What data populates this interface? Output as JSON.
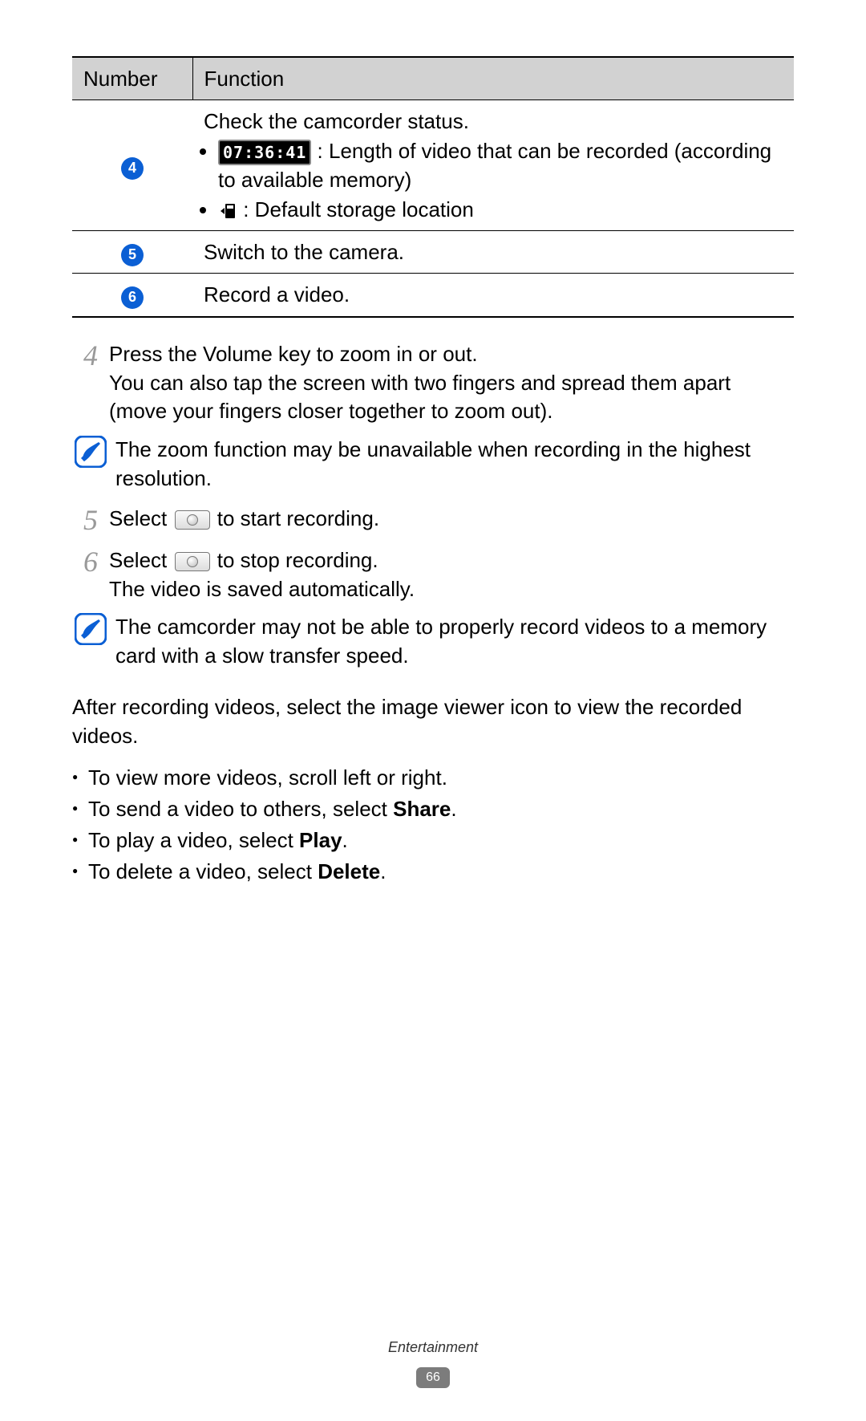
{
  "table": {
    "headers": [
      "Number",
      "Function"
    ],
    "rows": [
      {
        "num": "4",
        "intro": "Check the camcorder status.",
        "bullet1_time": "07:36:41",
        "bullet1_text": " : Length of video that can be recorded (according to available memory)",
        "bullet2_text": " : Default storage location"
      },
      {
        "num": "5",
        "text": "Switch to the camera."
      },
      {
        "num": "6",
        "text": "Record a video."
      }
    ]
  },
  "step4": {
    "num": "4",
    "line1": "Press the Volume key to zoom in or out.",
    "line2": "You can also tap the screen with two fingers and spread them apart (move your fingers closer together to zoom out)."
  },
  "note1": "The zoom function may be unavailable when recording in the highest resolution.",
  "step5": {
    "num": "5",
    "pre": "Select ",
    "post": " to start recording."
  },
  "step6": {
    "num": "6",
    "pre": "Select ",
    "post": " to stop recording.",
    "line2": "The video is saved automatically."
  },
  "note2": "The camcorder may not be able to properly record videos to a memory card with a slow transfer speed.",
  "para": "After recording videos, select the image viewer icon to view the recorded videos.",
  "list": [
    {
      "pre": "To view more videos, scroll left or right.",
      "bold": "",
      "post": ""
    },
    {
      "pre": "To send a video to others, select ",
      "bold": "Share",
      "post": "."
    },
    {
      "pre": "To play a video, select ",
      "bold": "Play",
      "post": "."
    },
    {
      "pre": "To delete a video, select ",
      "bold": "Delete",
      "post": "."
    }
  ],
  "footer": {
    "section": "Entertainment",
    "page": "66"
  }
}
